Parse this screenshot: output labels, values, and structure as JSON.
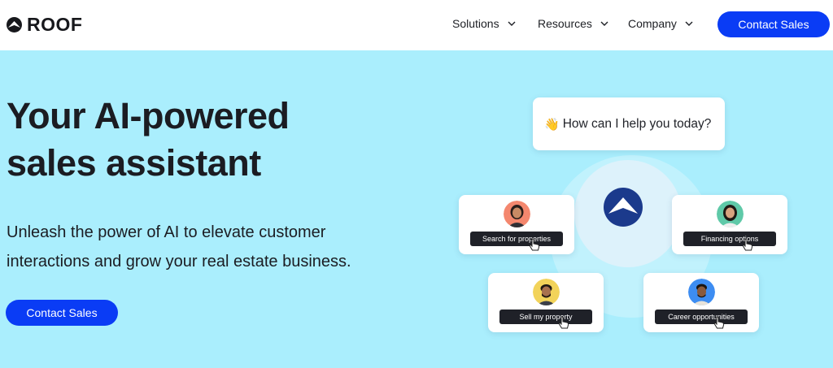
{
  "brand": {
    "name": "ROOF"
  },
  "nav": {
    "items": [
      {
        "label": "Solutions"
      },
      {
        "label": "Resources"
      },
      {
        "label": "Company"
      }
    ],
    "cta_label": "Contact Sales"
  },
  "hero": {
    "title_line1": "Your AI-powered",
    "title_line2": "sales assistant",
    "subtitle_line1": "Unleash the power of AI to elevate customer",
    "subtitle_line2": "interactions and grow your real estate business.",
    "cta_label": "Contact Sales"
  },
  "illustration": {
    "prompt": "How can I help you today?",
    "prompt_icon": "waving-hand-icon",
    "options": [
      {
        "label": "Search for properties",
        "avatar_color": "#f4876e"
      },
      {
        "label": "Financing options",
        "avatar_color": "#5fc9a8"
      },
      {
        "label": "Sell my property",
        "avatar_color": "#f2d35a"
      },
      {
        "label": "Career opportunities",
        "avatar_color": "#3d8df2"
      }
    ]
  },
  "colors": {
    "accent": "#0a3cf5",
    "hero_bg": "#aaeefd",
    "text_dark": "#1b1c22"
  }
}
